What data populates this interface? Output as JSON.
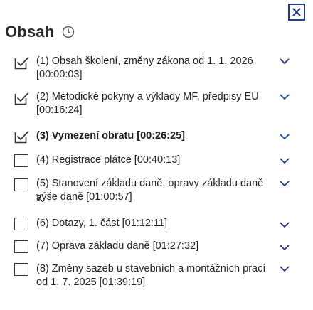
{
  "header": {
    "title": "Obsah"
  },
  "icons": {
    "close": "close-icon",
    "clock": "clock-icon",
    "checked": "checkmark-box-icon",
    "chevron": "chevron-down-icon"
  },
  "colors": {
    "accent": "#1f3a93",
    "text": "#222222"
  },
  "items": [
    {
      "label": "(1) Obsah školení, změny zákona od 1. 1. 2026",
      "time": "[00:00:03]",
      "checked": true,
      "current": false
    },
    {
      "label": "(2) Metodické pokyny a výklady MF, předpisy EU",
      "time": "[00:16:24]",
      "checked": true,
      "current": false
    },
    {
      "label": "(3) Vymezení obratu [00:26:25]",
      "checked": true,
      "current": true
    },
    {
      "label": "(4) Registrace plátce [00:40:13]",
      "checked": false,
      "current": false
    },
    {
      "label": "(5) Stanovení základu daně, opravy základu daně a",
      "time": "výše daně [01:00:57]",
      "checked": false,
      "current": false
    },
    {
      "label": "(6) Dotazy, 1. část [01:12:11]",
      "checked": false,
      "current": false
    },
    {
      "label": "(7) Oprava základu daně [01:27:32]",
      "checked": false,
      "current": false
    },
    {
      "label": "(8) Změny sazeb u stavebních a montážních prací",
      "time": "od 1. 7. 2025 [01:39:19]",
      "checked": false,
      "current": false
    }
  ]
}
